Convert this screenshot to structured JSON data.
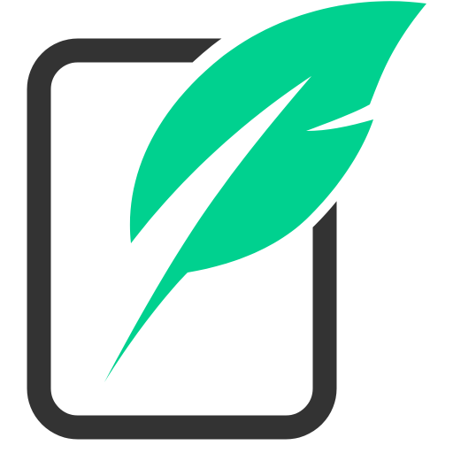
{
  "logo": {
    "icon": "document-with-feather-quill-icon",
    "colors": {
      "background": "#ffffff",
      "frame": "#333333",
      "feather": "#00d18f",
      "gap": "#ffffff"
    }
  }
}
